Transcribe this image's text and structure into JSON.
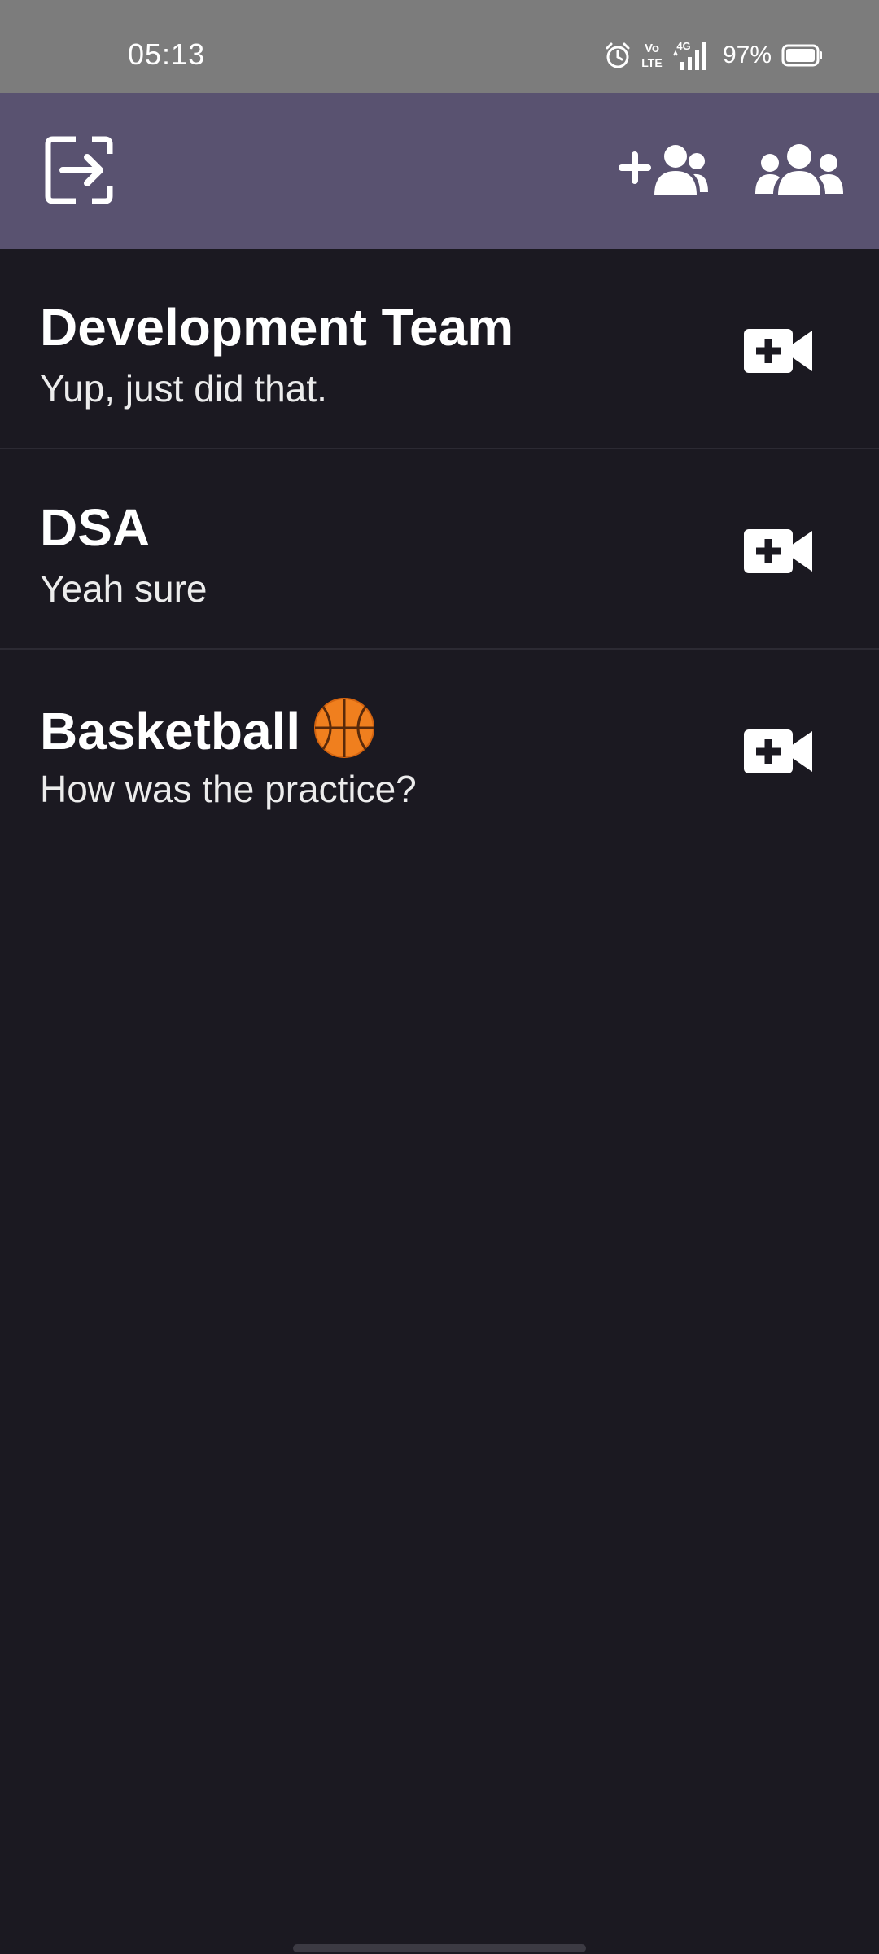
{
  "status_bar": {
    "time": "05:13",
    "network": "4G",
    "volte": "Vo LTE",
    "battery_percent": "97%",
    "icons": [
      "alarm-icon",
      "volte-icon",
      "signal-icon",
      "battery-icon"
    ]
  },
  "app_bar": {
    "icons": [
      "logout-icon",
      "add-group-icon",
      "groups-icon"
    ],
    "color": "#595270"
  },
  "chats": [
    {
      "title": "Development Team",
      "emoji": "",
      "last_message": "Yup, just did that."
    },
    {
      "title": "DSA",
      "emoji": "",
      "last_message": "Yeah sure"
    },
    {
      "title": "Basketball",
      "emoji": "🏀",
      "last_message": "How was the practice?"
    }
  ],
  "colors": {
    "background": "#1b1921",
    "status_bar": "#7c7c7c",
    "divider": "#2c2a33"
  }
}
